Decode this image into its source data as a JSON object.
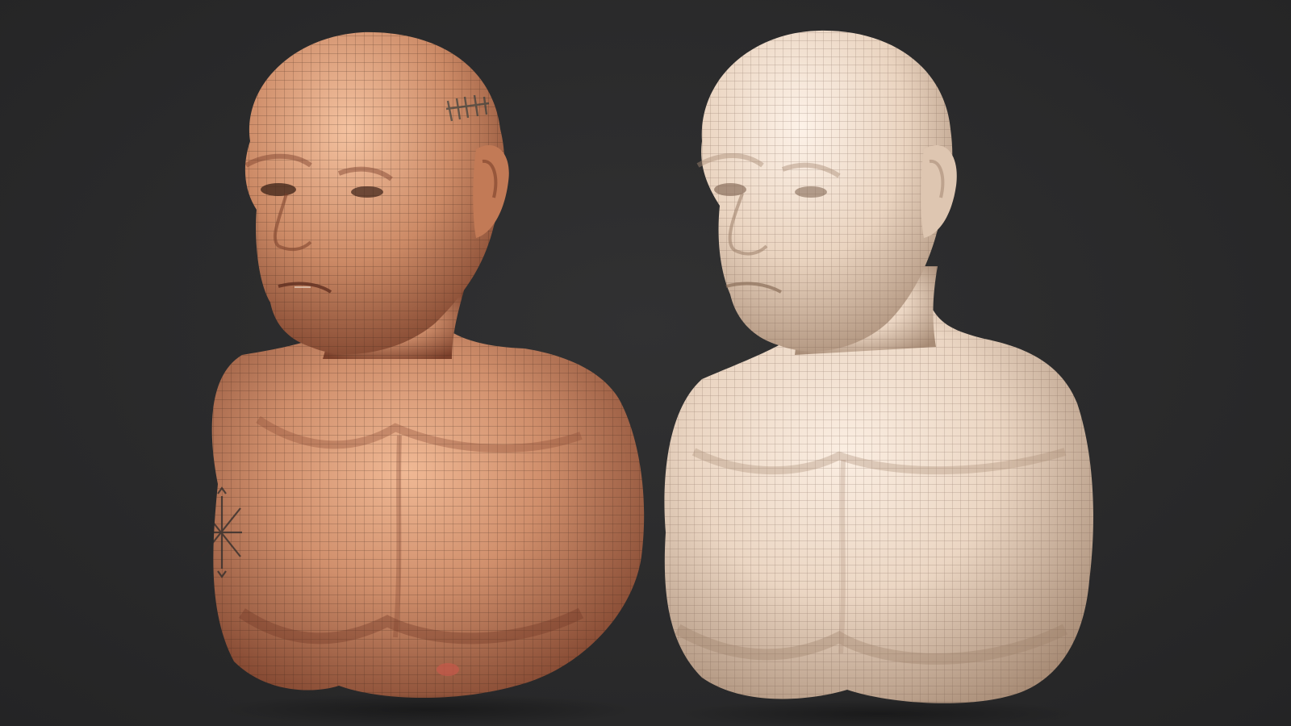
{
  "scene": {
    "background_color": "#2a2a2b",
    "busts": [
      {
        "id": "textured",
        "material": "textured skin",
        "skin_base": "#d08f6c",
        "skin_shadow": "#8a4a33",
        "skin_highlight": "#f0b995",
        "wire_color": "#3a2218",
        "tattoos": [
          "head-runes",
          "chest-compass"
        ]
      },
      {
        "id": "clay",
        "material": "clay",
        "skin_base": "#ebd6c3",
        "skin_shadow": "#b59a84",
        "skin_highlight": "#fbeee2",
        "wire_color": "#6b5243"
      }
    ]
  }
}
